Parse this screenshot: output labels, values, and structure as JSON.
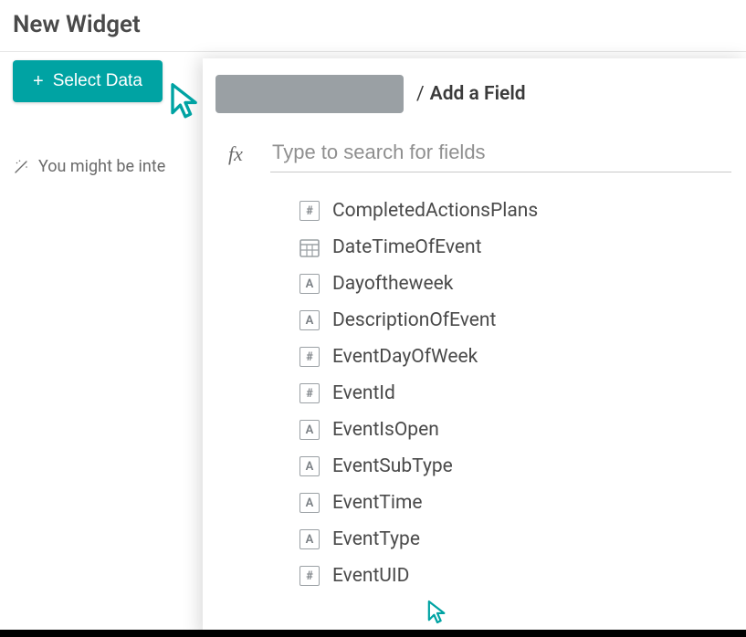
{
  "pageTitle": "New Widget",
  "selectButton": {
    "label": "Select Data"
  },
  "suggestion": {
    "text": "You might be inte"
  },
  "panel": {
    "breadcrumbLabel": "Add a Field",
    "searchPlaceholder": "Type to search for fields"
  },
  "fields": [
    {
      "type": "#",
      "name": "CompletedActionsPlans"
    },
    {
      "type": "datetime",
      "name": "DateTimeOfEvent"
    },
    {
      "type": "A",
      "name": "Dayoftheweek"
    },
    {
      "type": "A",
      "name": "DescriptionOfEvent"
    },
    {
      "type": "#",
      "name": "EventDayOfWeek"
    },
    {
      "type": "#",
      "name": "EventId"
    },
    {
      "type": "A",
      "name": "EventIsOpen"
    },
    {
      "type": "A",
      "name": "EventSubType"
    },
    {
      "type": "A",
      "name": "EventTime"
    },
    {
      "type": "A",
      "name": "EventType"
    },
    {
      "type": "#",
      "name": "EventUID"
    }
  ]
}
